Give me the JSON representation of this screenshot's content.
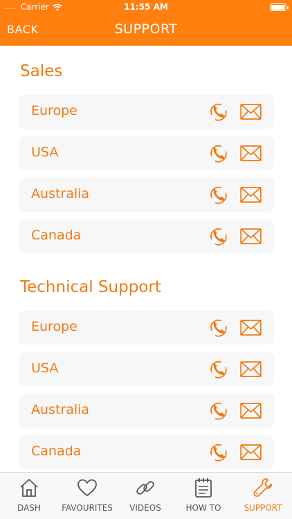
{
  "status": {
    "carrier": "Carrier",
    "time": "11:55 AM"
  },
  "nav": {
    "back": "BACK",
    "title": "SUPPORT"
  },
  "sections": [
    {
      "title": "Sales",
      "rows": [
        {
          "label": "Europe"
        },
        {
          "label": "USA"
        },
        {
          "label": "Australia"
        },
        {
          "label": "Canada"
        }
      ]
    },
    {
      "title": "Technical Support",
      "rows": [
        {
          "label": "Europe"
        },
        {
          "label": "USA"
        },
        {
          "label": "Australia"
        },
        {
          "label": "Canada"
        }
      ]
    }
  ],
  "tabs": [
    {
      "label": "DASH",
      "icon": "home-icon",
      "active": false
    },
    {
      "label": "FAVOURITES",
      "icon": "heart-icon",
      "active": false
    },
    {
      "label": "VIDEOS",
      "icon": "link-icon",
      "active": false
    },
    {
      "label": "HOW TO",
      "icon": "notepad-icon",
      "active": false
    },
    {
      "label": "SUPPORT",
      "icon": "wrench-icon",
      "active": true
    }
  ],
  "colors": {
    "accent": "#FF7F0F",
    "text_accent": "#EF7A12",
    "row_bg": "#F7F7F8",
    "tab_inactive": "#555555"
  }
}
